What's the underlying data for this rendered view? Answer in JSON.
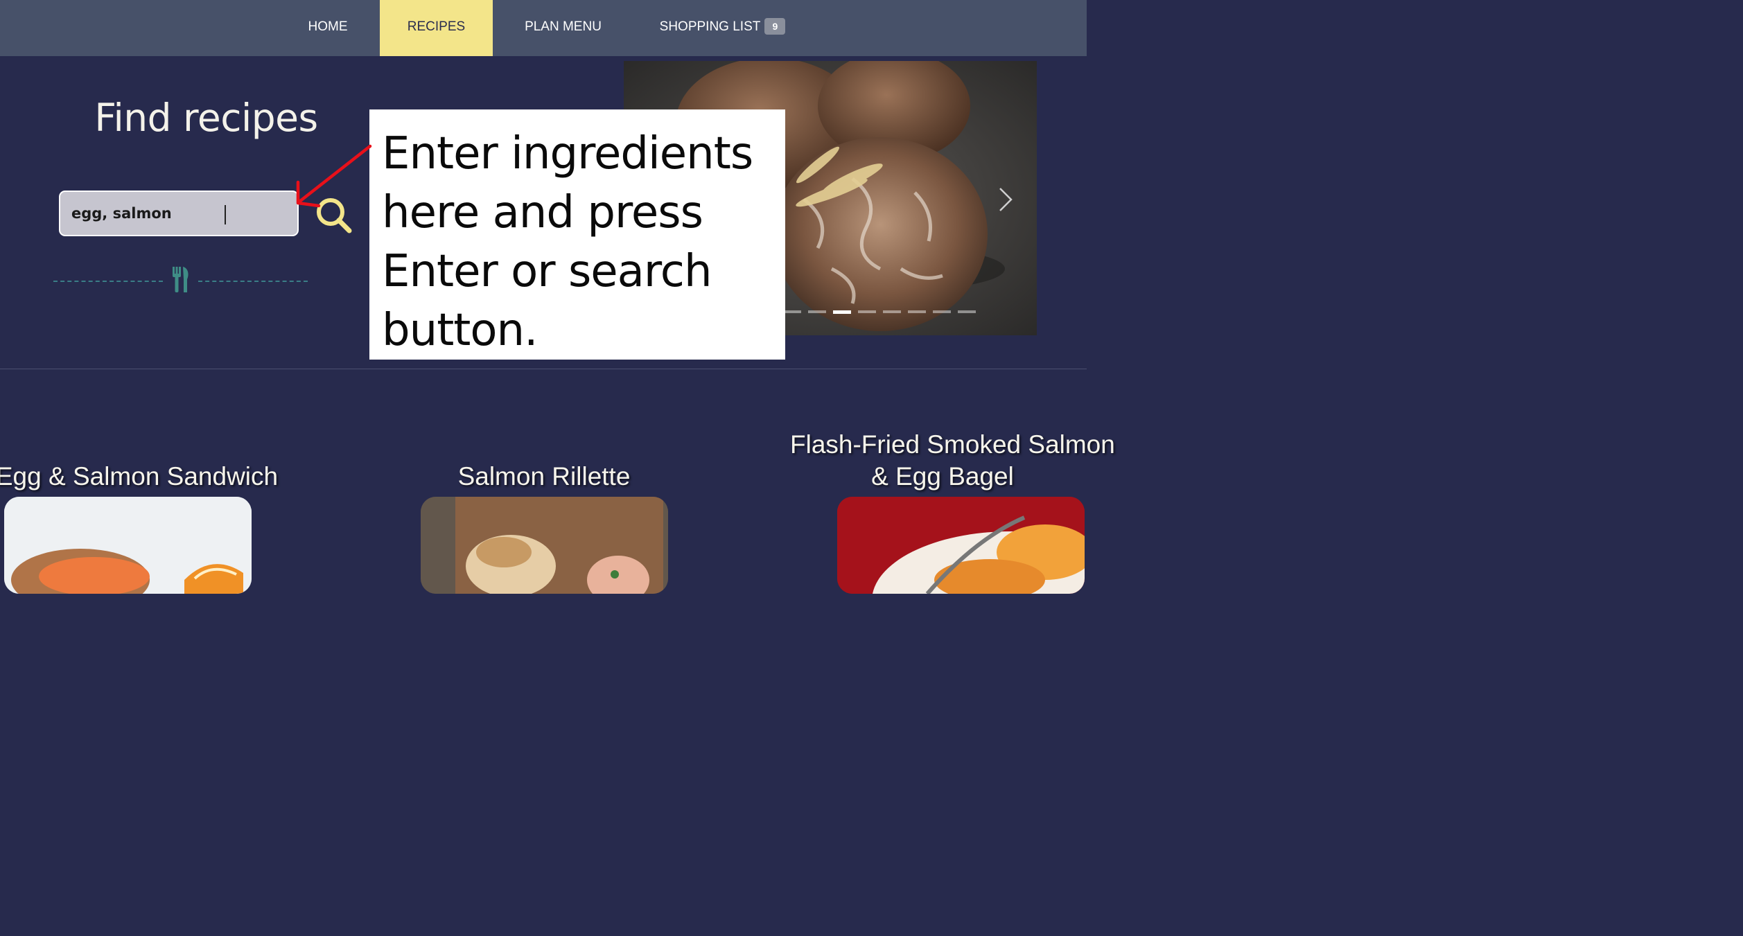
{
  "nav": {
    "items": [
      {
        "label": "HOME"
      },
      {
        "label": "RECIPES",
        "active": true
      },
      {
        "label": "PLAN MENU"
      },
      {
        "label": "SHOPPING LIST",
        "badge": "9"
      }
    ]
  },
  "hero": {
    "title": "Find recipes",
    "search": {
      "value": "egg, salmon"
    },
    "search_button_icon": "magnifier-icon",
    "divider_icon": "fork-knife-icon",
    "carousel": {
      "slide_count": 8,
      "active_slide": 3
    }
  },
  "tooltip": {
    "lines": [
      "Enter ingredients",
      "here and press",
      "Enter or search",
      "button."
    ]
  },
  "recipes": [
    {
      "title_lines": [
        "Egg & Salmon Sandwich"
      ]
    },
    {
      "title_lines": [
        "Salmon Rillette"
      ]
    },
    {
      "title_lines": [
        "Flash-Fried Smoked Salmon",
        "& Egg Bagel"
      ]
    }
  ],
  "colors": {
    "nav_bg": "#475169",
    "nav_active_bg": "#f3e58a",
    "page_bg": "#272a4d",
    "accent_yellow": "#f3e58a",
    "divider_teal": "#3a7e86",
    "annotation_red": "#e8101a"
  }
}
